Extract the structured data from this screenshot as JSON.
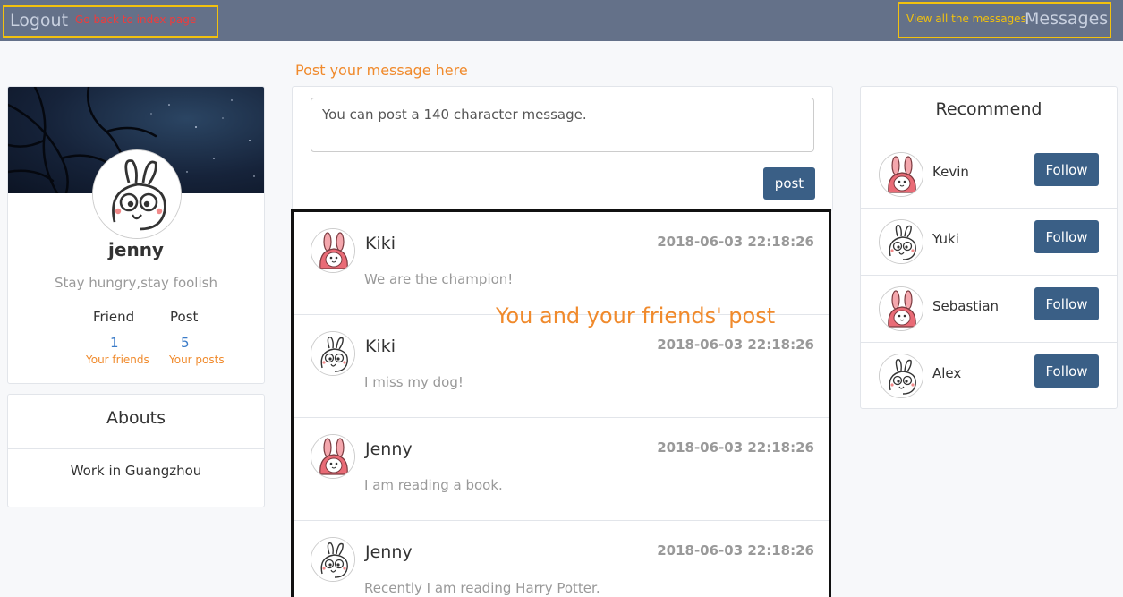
{
  "nav": {
    "logout": "Logout",
    "annotation_back": "Go back to index page",
    "annotation_messages": "View all the messages",
    "messages": "Messages"
  },
  "profile": {
    "name": "jenny",
    "motto": "Stay hungry,stay foolish",
    "friend_label": "Friend",
    "post_label": "Post",
    "friend_count": "1",
    "post_count": "5",
    "friend_annotation": "Your friends",
    "post_annotation": "Your posts",
    "avatar": "bunny-sketch"
  },
  "abouts": {
    "title": "Abouts",
    "text": "Work in Guangzhou"
  },
  "compose": {
    "annotation": "Post your message here",
    "placeholder": "You can post a 140 character message.",
    "button": "post"
  },
  "feed": {
    "annotation": "You and your friends' post",
    "posts": [
      {
        "name": "Kiki",
        "time": "2018-06-03 22:18:26",
        "text": "We are the champion!",
        "avatar": "pink-bunny"
      },
      {
        "name": "Kiki",
        "time": "2018-06-03 22:18:26",
        "text": "I miss my dog!",
        "avatar": "bunny-sketch"
      },
      {
        "name": "Jenny",
        "time": "2018-06-03 22:18:26",
        "text": "I am reading a book.",
        "avatar": "pink-bunny"
      },
      {
        "name": "Jenny",
        "time": "2018-06-03 22:18:26",
        "text": "Recently I am reading Harry Potter.",
        "avatar": "bunny-sketch"
      }
    ]
  },
  "recommend": {
    "title": "Recommend",
    "items": [
      {
        "name": "Kevin",
        "button": "Follow",
        "avatar": "pink-bunny"
      },
      {
        "name": "Yuki",
        "button": "Follow",
        "avatar": "bunny-sketch"
      },
      {
        "name": "Sebastian",
        "button": "Follow",
        "avatar": "pink-bunny"
      },
      {
        "name": "Alex",
        "button": "Follow",
        "avatar": "bunny-sketch"
      }
    ]
  },
  "colors": {
    "topbar": "#647189",
    "button": "#3a5f86",
    "annotation_orange": "#f08a2c",
    "annotation_box": "#f2c10e",
    "annotation_red": "#f03b3b"
  }
}
